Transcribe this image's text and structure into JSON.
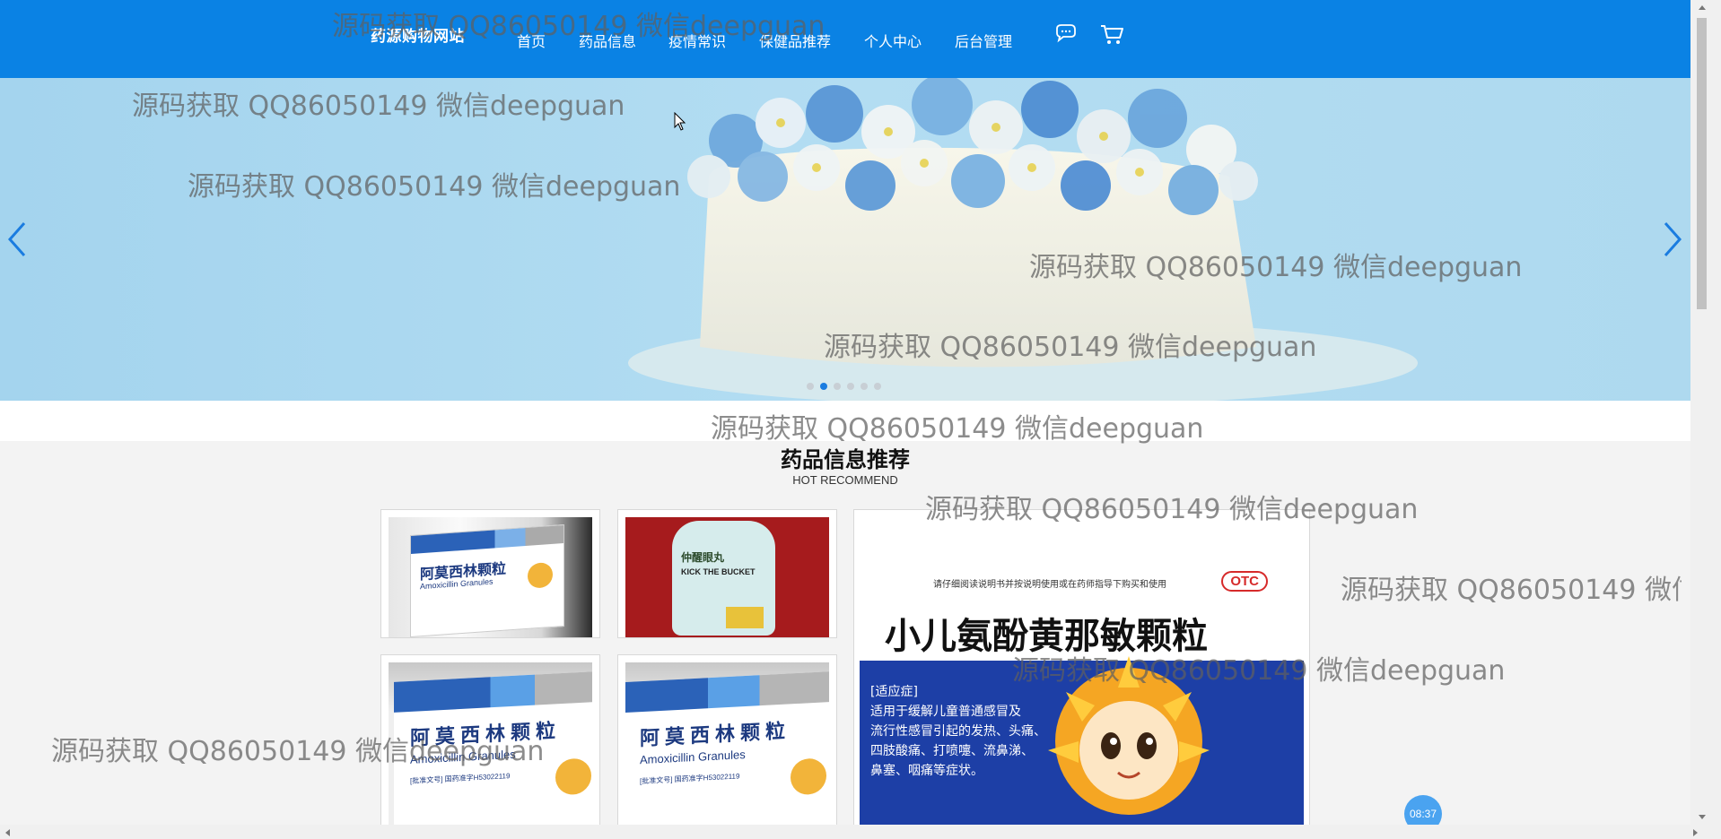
{
  "header": {
    "brand": "药源购物网站",
    "nav": [
      "首页",
      "药品信息",
      "疫情常识",
      "保健品推荐",
      "个人中心",
      "后台管理"
    ],
    "icons": [
      "chat-icon",
      "cart-icon"
    ],
    "bg_color": "#0a82e4"
  },
  "banner": {
    "dot_count": 6,
    "active_dot": 1,
    "prev_icon": "chevron-left-icon",
    "next_icon": "chevron-right-icon"
  },
  "section": {
    "title": "药品信息推荐",
    "subtitle": "HOT RECOMMEND"
  },
  "products": {
    "p1": {
      "name": "阿莫西林颗粒",
      "en": "Amoxicillin Granules"
    },
    "p2": {
      "name": "仲醒眼丸",
      "en": "KICK THE BUCKET"
    },
    "p3": {
      "name": "阿莫西林颗粒",
      "en": "Amoxicillin Granules",
      "approval": "[批准文号] 国药准字H53022119"
    },
    "p4": {
      "name": "阿莫西林颗粒",
      "en": "Amoxicillin Granules",
      "approval": "[批准文号] 国药准字H53022119"
    },
    "p5": {
      "name": "小儿氨酚黄那敏颗粒",
      "note": "请仔细阅读说明书并按说明使用或在药师指导下购买和使用",
      "badge": "OTC",
      "indication_label": "[适应症]",
      "indication": [
        "适用于缓解儿童普通感冒及",
        "流行性感冒引起的发热、头痛、",
        "四肢酸痛、打喷嚏、流鼻涕、",
        "鼻塞、咽痛等症状。"
      ]
    }
  },
  "watermark": "源码获取 QQ86050149 微信deepguan",
  "clock": "08:37"
}
